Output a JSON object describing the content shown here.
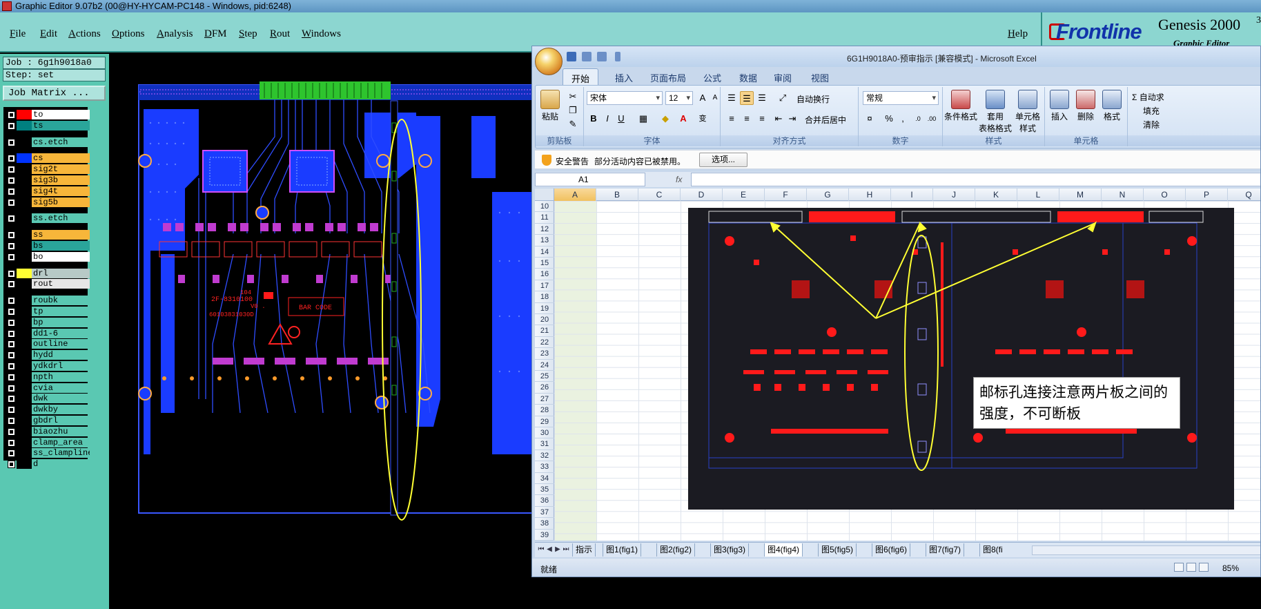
{
  "genesis": {
    "window_title": "Graphic Editor 9.07b2 (00@HY-HYCAM-PC148 - Windows, pid:6248)",
    "menus": [
      "File",
      "Edit",
      "Actions",
      "Options",
      "Analysis",
      "DFM",
      "Step",
      "Rout",
      "Windows"
    ],
    "help": "Help",
    "logo": {
      "brand": "Frontline",
      "product": "Genesis 2000",
      "version_sup": "3",
      "subtitle": "Graphic Editor"
    },
    "job_label": "Job : 6g1h9018a0",
    "step_label": "Step: set",
    "job_matrix_button": "Job Matrix ...",
    "layers": [
      {
        "name": "to",
        "swatch": "#ff0000",
        "label_bg": "#ffffff",
        "gap_before": false
      },
      {
        "name": "ts",
        "swatch": "#008080",
        "label_bg": "#2aa59a",
        "gap_before": false
      },
      {
        "name": "cs.etch",
        "swatch": "#000000",
        "label_bg": "#5ac8b2",
        "gap_before": true
      },
      {
        "name": "cs",
        "swatch": "#0033ff",
        "label_bg": "#f7b63a",
        "gap_before": true
      },
      {
        "name": "sig2t",
        "swatch": "#000000",
        "label_bg": "#f7b63a",
        "gap_before": false
      },
      {
        "name": "sig3b",
        "swatch": "#000000",
        "label_bg": "#f7b63a",
        "gap_before": false
      },
      {
        "name": "sig4t",
        "swatch": "#000000",
        "label_bg": "#f7b63a",
        "gap_before": false
      },
      {
        "name": "sig5b",
        "swatch": "#000000",
        "label_bg": "#f7b63a",
        "gap_before": false
      },
      {
        "name": "ss.etch",
        "swatch": "#000000",
        "label_bg": "#5ac8b2",
        "gap_before": true
      },
      {
        "name": "ss",
        "swatch": "#000000",
        "label_bg": "#f7b63a",
        "gap_before": true
      },
      {
        "name": "bs",
        "swatch": "#000000",
        "label_bg": "#2aa59a",
        "gap_before": false
      },
      {
        "name": "bo",
        "swatch": "#000000",
        "label_bg": "#ffffff",
        "gap_before": false
      },
      {
        "name": "drl",
        "swatch": "#ffff33",
        "label_bg": "#b7c9c6",
        "gap_before": true
      },
      {
        "name": "rout",
        "swatch": "#000000",
        "label_bg": "#e6e6e6",
        "gap_before": false
      },
      {
        "name": "roubk",
        "swatch": "#000000",
        "label_bg": "#5ac8b2",
        "gap_before": true
      },
      {
        "name": "tp",
        "swatch": "#000000",
        "label_bg": "#5ac8b2",
        "gap_before": false
      },
      {
        "name": "bp",
        "swatch": "#000000",
        "label_bg": "#5ac8b2",
        "gap_before": false
      },
      {
        "name": "dd1-6",
        "swatch": "#000000",
        "label_bg": "#5ac8b2",
        "gap_before": false
      },
      {
        "name": "outline",
        "swatch": "#000000",
        "label_bg": "#5ac8b2",
        "gap_before": false
      },
      {
        "name": "hydd",
        "swatch": "#000000",
        "label_bg": "#5ac8b2",
        "gap_before": false
      },
      {
        "name": "ydkdrl",
        "swatch": "#000000",
        "label_bg": "#5ac8b2",
        "gap_before": false
      },
      {
        "name": "npth",
        "swatch": "#000000",
        "label_bg": "#5ac8b2",
        "gap_before": false
      },
      {
        "name": "cvia",
        "swatch": "#000000",
        "label_bg": "#5ac8b2",
        "gap_before": false
      },
      {
        "name": "dwk",
        "swatch": "#000000",
        "label_bg": "#5ac8b2",
        "gap_before": false
      },
      {
        "name": "dwkby",
        "swatch": "#000000",
        "label_bg": "#5ac8b2",
        "gap_before": false
      },
      {
        "name": "gbdrl",
        "swatch": "#000000",
        "label_bg": "#5ac8b2",
        "gap_before": false
      },
      {
        "name": "biaozhu",
        "swatch": "#000000",
        "label_bg": "#5ac8b2",
        "gap_before": false
      },
      {
        "name": "clamp_area",
        "swatch": "#000000",
        "label_bg": "#5ac8b2",
        "gap_before": false
      },
      {
        "name": "ss_clampline",
        "swatch": "#000000",
        "label_bg": "#5ac8b2",
        "gap_before": false
      },
      {
        "name": "d",
        "swatch": "#000000",
        "label_bg": "#5ac8b2",
        "gap_before": false
      }
    ],
    "board_text": {
      "code_1": "104",
      "code_2": "2F-8310100",
      "code_3": "V0 .",
      "code_4": "60103831030D",
      "bar_code": "BAR CODE"
    }
  },
  "excel": {
    "window_title": "6G1H9018A0-预审指示 [兼容模式] - Microsoft Excel",
    "tabs": [
      "开始",
      "插入",
      "页面布局",
      "公式",
      "数据",
      "审阅",
      "视图"
    ],
    "active_tab": "开始",
    "clipboard": {
      "paste": "粘贴",
      "label": "剪贴板"
    },
    "font": {
      "name": "宋体",
      "size": "12",
      "label": "字体",
      "bold": "B",
      "italic": "I",
      "underline": "U",
      "color_letter": "A",
      "phonetic": "变"
    },
    "alignment": {
      "wrap": "自动换行",
      "merge": "合并后居中",
      "label": "对齐方式"
    },
    "number": {
      "format": "常规",
      "percent": "%",
      "comma": ",",
      "label": "数字"
    },
    "styles": {
      "conditional": "条件格式",
      "table_line1": "套用",
      "table_line2": "表格格式",
      "cell_line1": "单元格",
      "cell_line2": "样式",
      "label": "样式"
    },
    "cells": {
      "insert": "插入",
      "delete": "删除",
      "format": "格式",
      "label": "单元格"
    },
    "editing": {
      "autosum": "Σ 自动求",
      "fill": "填充",
      "clear": "清除"
    },
    "security": {
      "title": "安全警告",
      "message": "部分活动内容已被禁用。",
      "button": "选项..."
    },
    "name_box": "A1",
    "fx": "fx",
    "columns": [
      "A",
      "B",
      "C",
      "D",
      "E",
      "F",
      "G",
      "H",
      "I",
      "J",
      "K",
      "L",
      "M",
      "N",
      "O",
      "P",
      "Q"
    ],
    "rows": [
      "10",
      "11",
      "12",
      "13",
      "14",
      "15",
      "16",
      "17",
      "18",
      "19",
      "20",
      "21",
      "22",
      "23",
      "24",
      "25",
      "26",
      "27",
      "28",
      "29",
      "30",
      "31",
      "32",
      "33",
      "34",
      "35",
      "36",
      "37",
      "38",
      "39"
    ],
    "note": "邮标孔连接注意两片板之间的强度，不可断板",
    "sheets": [
      "指示",
      "图1(fig1)",
      "图2(fig2)",
      "图3(fig3)",
      "图4(fig4)",
      "图5(fig5)",
      "图6(fig6)",
      "图7(fig7)",
      "图8(fi"
    ],
    "active_sheet": "图4(fig4)",
    "status": "就绪",
    "zoom": "85%"
  },
  "colors": {
    "genesis_panel": "#5ac8b2",
    "pcb_blue": "#1a3cff",
    "pcb_red": "#ff1a1a",
    "pcb_magenta": "#c03bd0",
    "annotation_yellow": "#ffff33"
  }
}
